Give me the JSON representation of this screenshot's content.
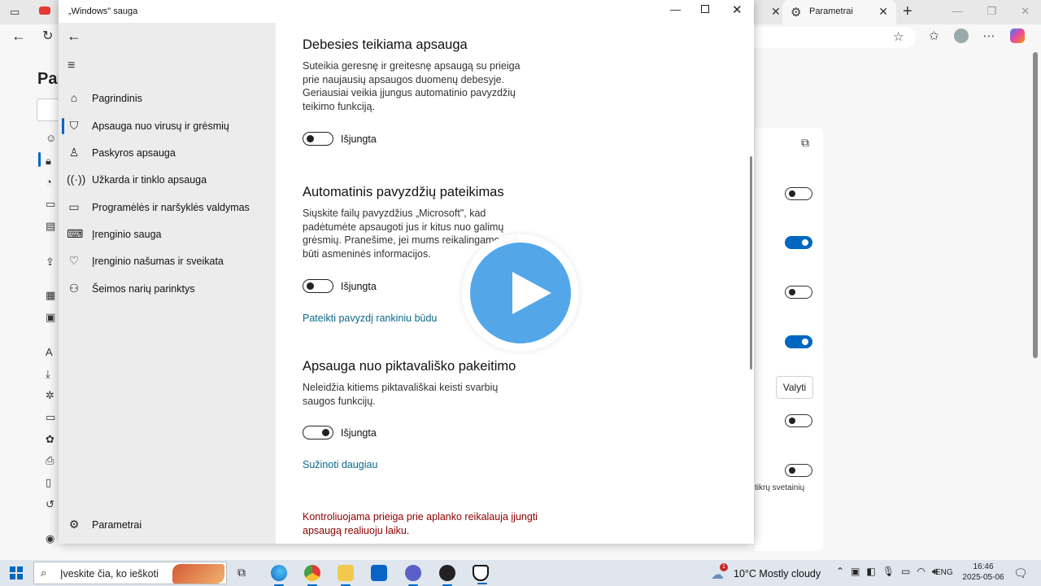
{
  "browser": {
    "active_tab_label": "Parametrai",
    "settings_title": "Par",
    "right_panel": {
      "toggles": [
        false,
        true,
        false,
        true,
        false,
        false
      ],
      "clear_button": "Valyti",
      "sites_text": "tikrų svetainių"
    }
  },
  "window": {
    "title": "„Windows\" sauga",
    "nav": {
      "items": [
        {
          "label": "Pagrindinis",
          "icon": "home-icon"
        },
        {
          "label": "Apsauga nuo virusų ir grėsmių",
          "icon": "shield-icon"
        },
        {
          "label": "Paskyros apsauga",
          "icon": "person-icon"
        },
        {
          "label": "Užkarda ir tinklo apsauga",
          "icon": "wifi-icon"
        },
        {
          "label": "Programėlės ir naršyklės valdymas",
          "icon": "app-window-icon"
        },
        {
          "label": "Įrenginio sauga",
          "icon": "laptop-icon"
        },
        {
          "label": "Įrenginio našumas ir sveikata",
          "icon": "heart-icon"
        },
        {
          "label": "Šeimos narių parinktys",
          "icon": "family-icon"
        }
      ],
      "active_index": 1,
      "settings_label": "Parametrai"
    },
    "sections": {
      "cloud": {
        "heading": "Debesies teikiama apsauga",
        "description": "Suteikia geresnę ir greitesnę apsaugą su prieiga prie naujausių apsaugos duomenų debesyje. Geriausiai veikia įjungus automatinio pavyzdžių teikimo funkciją.",
        "toggle_label": "Išjungta"
      },
      "sample": {
        "heading": "Automatinis pavyzdžių pateikimas",
        "description": "Siųskite failų pavyzdžius „Microsoft\", kad padėtumėte apsaugoti jus ir kitus nuo galimų grėsmių. Pranešime, jei mums reikalingame gali būti asmeninės informacijos.",
        "toggle_label": "Išjungta",
        "link": "Pateikti pavyzdį rankiniu būdu"
      },
      "tamper": {
        "heading": "Apsauga nuo piktavališko pakeitimo",
        "description": "Neleidžia kitiems piktavališkai keisti svarbių saugos funkcijų.",
        "toggle_label": "Išjungta",
        "link": "Sužinoti daugiau"
      },
      "warning": "Kontroliuojama prieiga prie aplanko reikalauja įjungti apsaugą realiuoju laiku."
    }
  },
  "taskbar": {
    "search_placeholder": "Įveskite čia, ko ieškoti",
    "weather": "10°C  Mostly cloudy",
    "weather_badge": "1",
    "language": "ENG",
    "time": "16:46",
    "date": "2025-05-06"
  }
}
